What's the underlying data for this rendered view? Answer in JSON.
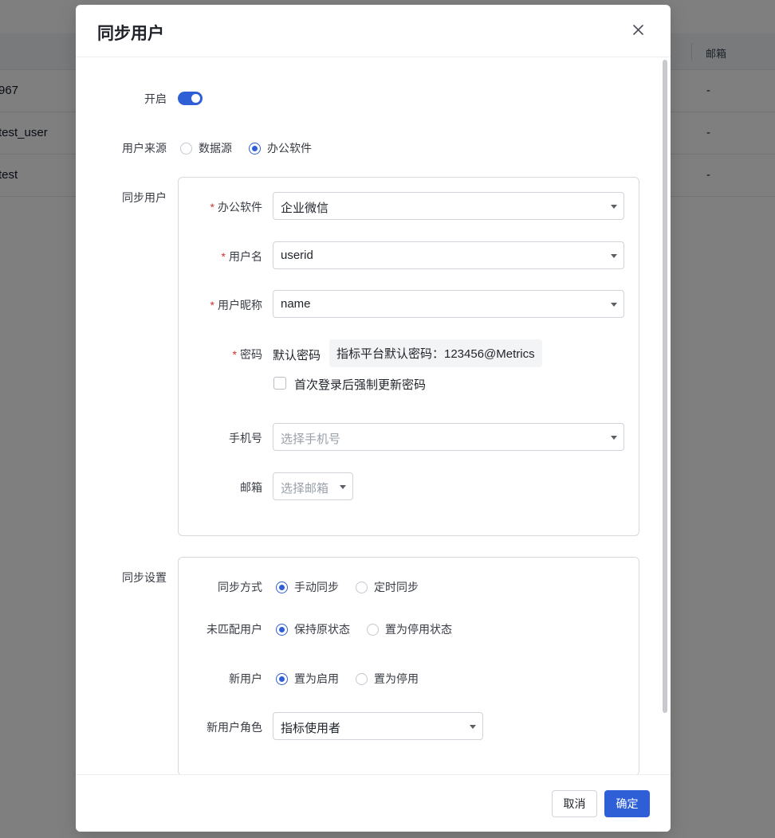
{
  "background": {
    "column_email": "邮箱",
    "rows": [
      {
        "name": "967",
        "email": "-"
      },
      {
        "name": "test_user",
        "email": "-"
      },
      {
        "name": "test",
        "email": "-"
      }
    ]
  },
  "modal": {
    "title": "同步用户",
    "enable_label": "开启",
    "source_label": "用户来源",
    "source_options": [
      {
        "label": "数据源",
        "checked": false
      },
      {
        "label": "办公软件",
        "checked": true
      }
    ],
    "sync_user_label": "同步用户",
    "sync_user": {
      "office_label": "办公软件",
      "office_value": "企业微信",
      "username_label": "用户名",
      "username_value": "userid",
      "nickname_label": "用户昵称",
      "nickname_value": "name",
      "password_label": "密码",
      "password_mode": "默认密码",
      "password_default": "指标平台默认密码：123456@Metrics",
      "force_change_label": "首次登录后强制更新密码",
      "phone_label": "手机号",
      "phone_placeholder": "选择手机号",
      "email_label": "邮箱",
      "email_placeholder": "选择邮箱"
    },
    "sync_settings_label": "同步设置",
    "sync_settings": {
      "method_label": "同步方式",
      "method_manual": "手动同步",
      "method_scheduled": "定时同步",
      "unmatched_label": "未匹配用户",
      "unmatched_keep": "保持原状态",
      "unmatched_disable": "置为停用状态",
      "new_user_label": "新用户",
      "new_user_enable": "置为启用",
      "new_user_disable": "置为停用",
      "new_role_label": "新用户角色",
      "new_role_value": "指标使用者"
    },
    "cancel_label": "取消",
    "ok_label": "确定"
  },
  "colors": {
    "primary": "#2f5fd6",
    "required": "#d0342c"
  }
}
